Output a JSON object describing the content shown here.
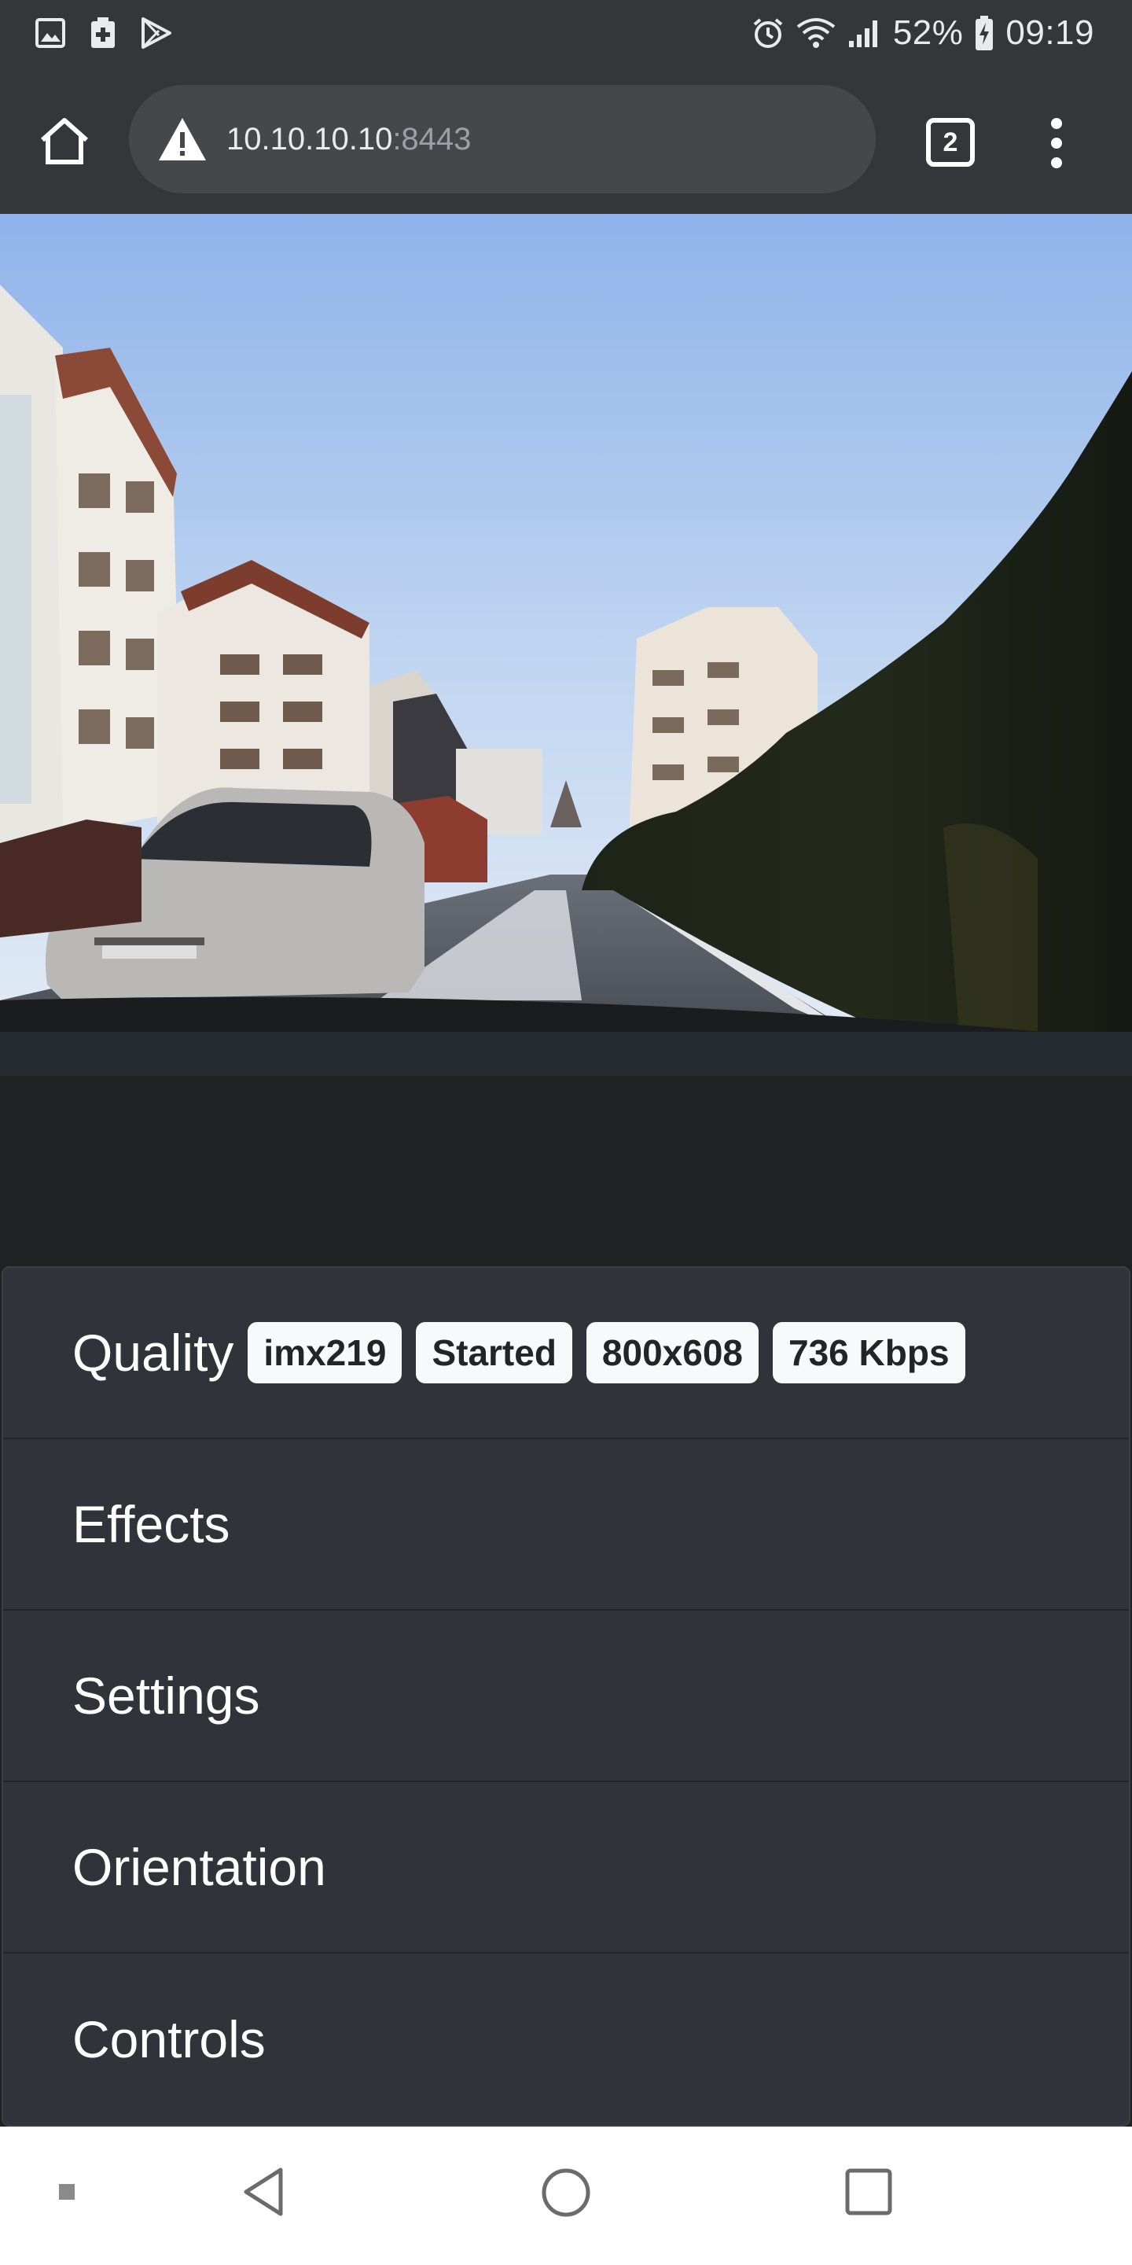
{
  "status_bar": {
    "battery_percent": "52%",
    "time": "09:19",
    "icons": [
      "gallery-icon",
      "medical-app-icon",
      "play-store-icon",
      "alarm-icon",
      "wifi-icon",
      "signal-icon",
      "battery-charging-icon"
    ]
  },
  "browser": {
    "url_host": "10.10.10.10",
    "url_port": ":8443",
    "tab_count": "2",
    "security_icon": "warning-triangle-icon"
  },
  "camera_view": {
    "description_icon": "live-camera-stream"
  },
  "panel": {
    "quality": {
      "label": "Quality",
      "badges": [
        "imx219",
        "Started",
        "800x608",
        "736 Kbps"
      ]
    },
    "effects_label": "Effects",
    "settings_label": "Settings",
    "orientation_label": "Orientation",
    "controls_label": "Controls"
  },
  "nav_bar": {
    "icons": [
      "small-square-icon",
      "back-icon",
      "home-circle-icon",
      "recents-icon"
    ]
  },
  "colors": {
    "browser_chrome": "#35363a",
    "omnibox": "#46474b",
    "panel_bg": "#30343a",
    "badge_bg": "#f8f9fa",
    "page_bg": "#202124"
  }
}
